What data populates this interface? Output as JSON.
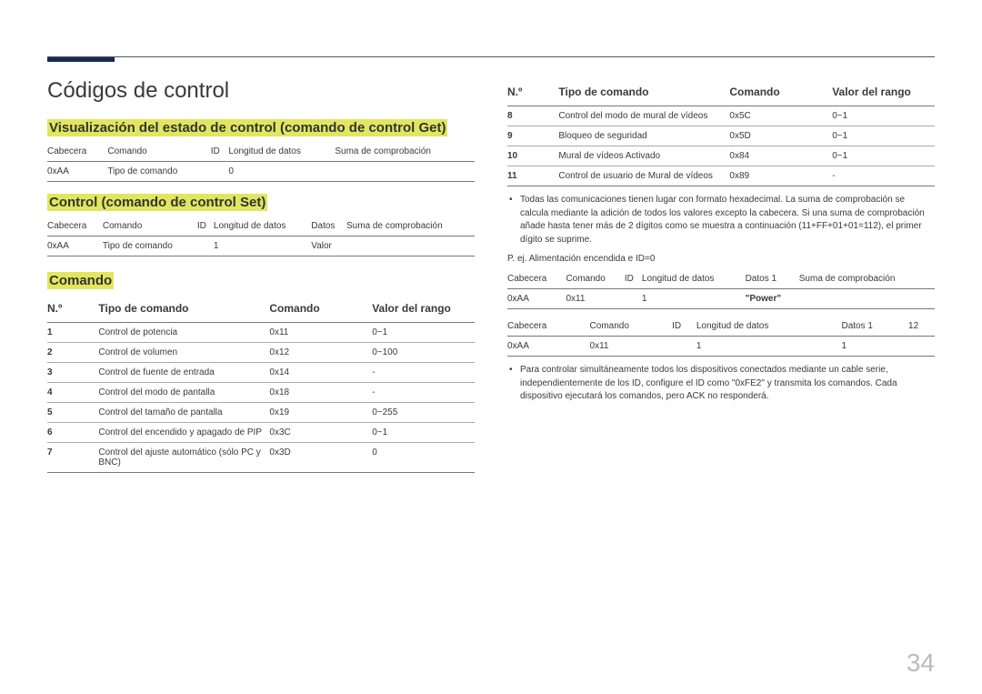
{
  "page_number": "34",
  "title": "Códigos de control",
  "sec_get": {
    "heading": "Visualización del estado de control (comando de control Get)",
    "headers": [
      "Cabecera",
      "Comando",
      "ID",
      "Longitud de datos",
      "Suma de comprobación"
    ],
    "row": [
      "0xAA",
      "Tipo de comando",
      "",
      "0",
      ""
    ]
  },
  "sec_set": {
    "heading": "Control (comando de control Set)",
    "headers": [
      "Cabecera",
      "Comando",
      "ID",
      "Longitud de datos",
      "Datos",
      "Suma de comprobación"
    ],
    "row": [
      "0xAA",
      "Tipo de comando",
      "",
      "1",
      "Valor",
      ""
    ]
  },
  "sec_cmd": {
    "heading": "Comando",
    "col_labels": {
      "no": "N.º",
      "tipo": "Tipo de comando",
      "comando": "Comando",
      "rango": "Valor del rango"
    },
    "rows_left": [
      {
        "n": "1",
        "t": "Control de potencia",
        "c": "0x11",
        "r": "0~1"
      },
      {
        "n": "2",
        "t": "Control de volumen",
        "c": "0x12",
        "r": "0~100"
      },
      {
        "n": "3",
        "t": "Control de fuente de entrada",
        "c": "0x14",
        "r": "-"
      },
      {
        "n": "4",
        "t": "Control del modo de pantalla",
        "c": "0x18",
        "r": "-"
      },
      {
        "n": "5",
        "t": "Control del tamaño de pantalla",
        "c": "0x19",
        "r": "0~255"
      },
      {
        "n": "6",
        "t": "Control del encendido y apagado de PIP",
        "c": "0x3C",
        "r": "0~1"
      },
      {
        "n": "7",
        "t": "Control del ajuste automático (sólo PC y BNC)",
        "c": "0x3D",
        "r": "0"
      }
    ],
    "rows_right": [
      {
        "n": "8",
        "t": "Control del modo de mural de vídeos",
        "c": "0x5C",
        "r": "0~1"
      },
      {
        "n": "9",
        "t": "Bloqueo de seguridad",
        "c": "0x5D",
        "r": "0~1"
      },
      {
        "n": "10",
        "t": "Mural de vídeos Activado",
        "c": "0x84",
        "r": "0~1"
      },
      {
        "n": "11",
        "t": "Control de usuario de Mural de vídeos",
        "c": "0x89",
        "r": "-"
      }
    ]
  },
  "note1": "Todas las comunicaciones tienen lugar con formato hexadecimal. La suma de comprobación se calcula mediante la adición de todos los valores excepto la cabecera. Si una suma de comprobación añade hasta tener más de 2 dígitos como se muestra a continuación (11+FF+01+01=112), el primer dígito se suprime.",
  "example_label": "P. ej. Alimentación encendida e ID=0",
  "ex_table_a": {
    "headers": [
      "Cabecera",
      "Comando",
      "ID",
      "Longitud de datos",
      "Datos 1",
      "Suma de comprobación"
    ],
    "row": [
      "0xAA",
      "0x11",
      "",
      "1",
      "\"Power\"",
      ""
    ]
  },
  "ex_table_b": {
    "headers": [
      "Cabecera",
      "Comando",
      "ID",
      "Longitud de datos",
      "Datos 1",
      "12"
    ],
    "row": [
      "0xAA",
      "0x11",
      "",
      "1",
      "1",
      ""
    ]
  },
  "note2": "Para controlar simultáneamente todos los dispositivos conectados mediante un cable serie, independientemente de los ID, configure el ID como \"0xFE2\" y transmita los comandos. Cada dispositivo ejecutará los comandos, pero ACK no responderá."
}
